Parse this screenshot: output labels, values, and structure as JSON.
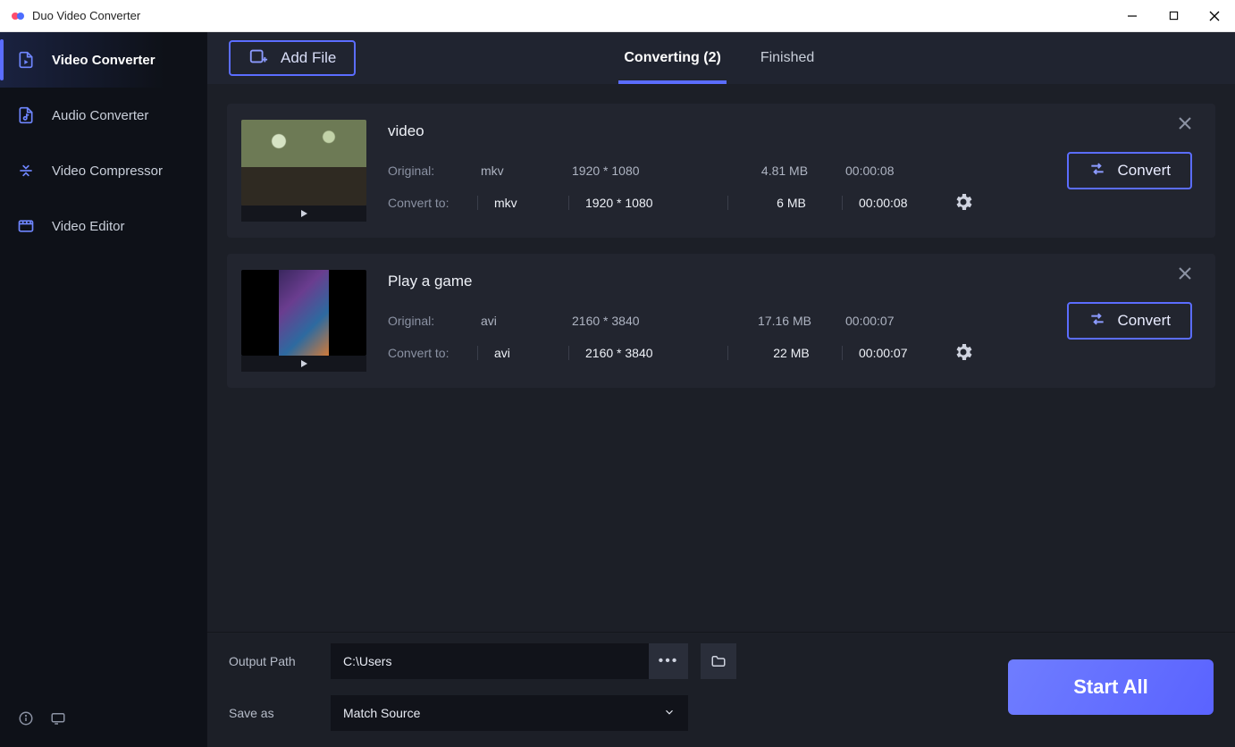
{
  "window": {
    "title": "Duo Video Converter"
  },
  "sidebar": {
    "items": [
      {
        "label": "Video Converter",
        "icon": "file-video-icon"
      },
      {
        "label": "Audio Converter",
        "icon": "file-audio-icon"
      },
      {
        "label": "Video Compressor",
        "icon": "compress-icon"
      },
      {
        "label": "Video Editor",
        "icon": "film-icon"
      }
    ]
  },
  "topbar": {
    "add_file_label": "Add File",
    "tabs": {
      "converting_label": "Converting (2)",
      "finished_label": "Finished"
    }
  },
  "rows": {
    "original_label": "Original:",
    "convert_to_label": "Convert to:",
    "convert_button_label": "Convert"
  },
  "files": [
    {
      "name": "video",
      "thumb_style": "forest",
      "original": {
        "format": "mkv",
        "resolution": "1920 * 1080",
        "size": "4.81 MB",
        "duration": "00:00:08"
      },
      "target": {
        "format": "mkv",
        "resolution": "1920 * 1080",
        "size": "6 MB",
        "duration": "00:00:08"
      }
    },
    {
      "name": "Play a game",
      "thumb_style": "portrait",
      "original": {
        "format": "avi",
        "resolution": "2160 * 3840",
        "size": "17.16 MB",
        "duration": "00:00:07"
      },
      "target": {
        "format": "avi",
        "resolution": "2160 * 3840",
        "size": "22 MB",
        "duration": "00:00:07"
      }
    }
  ],
  "bottom": {
    "output_path_label": "Output Path",
    "output_path_value": "C:\\Users",
    "save_as_label": "Save as",
    "save_as_value": "Match Source",
    "start_all_label": "Start All"
  }
}
